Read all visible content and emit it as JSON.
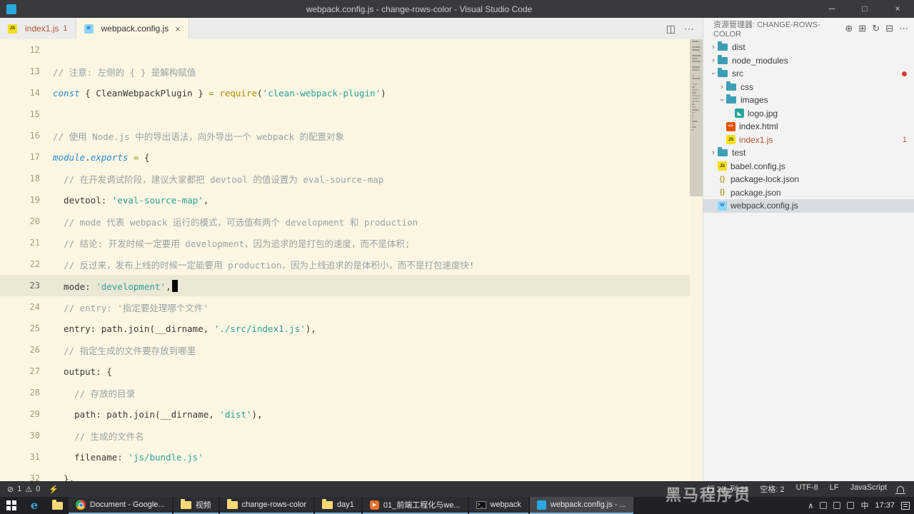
{
  "window": {
    "title": "webpack.config.js - change-rows-color - Visual Studio Code",
    "controls": {
      "minimize": "─",
      "maximize": "□",
      "close": "×"
    }
  },
  "colors": {
    "folder": "#3d9fb5",
    "js_icon": "#f5de19",
    "html_icon": "#e65100",
    "json_icon_text": "#b0a12f",
    "image_icon": "#26a69a",
    "webpack_icon": "#8ed6fb",
    "error_text": "#b4532a",
    "red_dot": "#d2402e",
    "keyword": "#268bd2",
    "string": "#2aa198",
    "comment": "#98a3a3",
    "editor_bg": "#fdf6e3",
    "current_line_bg": "#ece8d6"
  },
  "tabs": [
    {
      "label": "index1.js",
      "icon": "js",
      "badge": "1",
      "error": true,
      "active": false
    },
    {
      "label": "webpack.config.js",
      "icon": "webpack",
      "close": "×",
      "active": true
    }
  ],
  "editor_actions": [
    {
      "name": "split-editor-icon",
      "glyph": "◫"
    },
    {
      "name": "more-actions-icon",
      "glyph": "⋯"
    }
  ],
  "editor": {
    "cursor_line": 23,
    "minimap_head": [
      9,
      0,
      12,
      11,
      0,
      13,
      8,
      12,
      0,
      11,
      10
    ],
    "lines": [
      {
        "n": 12,
        "tokens": []
      },
      {
        "n": 13,
        "tokens": [
          [
            "cm",
            "// 注意: 左侧的 { } 是解构赋值"
          ]
        ]
      },
      {
        "n": 14,
        "tokens": [
          [
            "kw",
            "const"
          ],
          [
            "pn",
            " { CleanWebpackPlugin } "
          ],
          [
            "op",
            "="
          ],
          [
            "pn",
            " "
          ],
          [
            "fn",
            "require"
          ],
          [
            "pn",
            "("
          ],
          [
            "st",
            "'clean-webpack-plugin'"
          ],
          [
            "pn",
            ")"
          ]
        ]
      },
      {
        "n": 15,
        "tokens": []
      },
      {
        "n": 16,
        "tokens": [
          [
            "cm",
            "// 使用 Node.js 中的导出语法，向外导出一个 webpack 的配置对象"
          ]
        ]
      },
      {
        "n": 17,
        "tokens": [
          [
            "kw",
            "module"
          ],
          [
            "pn",
            "."
          ],
          [
            "kw",
            "exports"
          ],
          [
            "pn",
            " "
          ],
          [
            "op",
            "="
          ],
          [
            "pn",
            " {"
          ]
        ]
      },
      {
        "n": 18,
        "tokens": [
          [
            "pn",
            "  "
          ],
          [
            "cm",
            "// 在开发调试阶段，建议大家都把 devtool 的值设置为 eval-source-map"
          ]
        ]
      },
      {
        "n": 19,
        "tokens": [
          [
            "pn",
            "  devtool: "
          ],
          [
            "st",
            "'eval-source-map'"
          ],
          [
            "pn",
            ","
          ]
        ]
      },
      {
        "n": 20,
        "tokens": [
          [
            "pn",
            "  "
          ],
          [
            "cm",
            "// mode 代表 webpack 运行的模式，可选值有两个 development 和 production"
          ]
        ]
      },
      {
        "n": 21,
        "tokens": [
          [
            "pn",
            "  "
          ],
          [
            "cm",
            "// 结论: 开发时候一定要用 development，因为追求的是打包的速度，而不是体积;"
          ]
        ]
      },
      {
        "n": 22,
        "tokens": [
          [
            "pn",
            "  "
          ],
          [
            "cm",
            "// 反过来，发布上线的时候一定能要用 production，因为上线追求的是体积小，而不是打包速度快!"
          ]
        ]
      },
      {
        "n": 23,
        "current": true,
        "cursor": true,
        "tokens": [
          [
            "pn",
            "  mode: "
          ],
          [
            "st",
            "'development'"
          ],
          [
            "pn",
            ","
          ]
        ]
      },
      {
        "n": 24,
        "tokens": [
          [
            "pn",
            "  "
          ],
          [
            "cm",
            "// entry: '指定要处理哪个文件'"
          ]
        ]
      },
      {
        "n": 25,
        "tokens": [
          [
            "pn",
            "  entry: path.join(__dirname, "
          ],
          [
            "st",
            "'./src/index1.js'"
          ],
          [
            "pn",
            "),"
          ]
        ]
      },
      {
        "n": 26,
        "tokens": [
          [
            "pn",
            "  "
          ],
          [
            "cm",
            "// 指定生成的文件要存放到哪里"
          ]
        ]
      },
      {
        "n": 27,
        "tokens": [
          [
            "pn",
            "  output: {"
          ]
        ]
      },
      {
        "n": 28,
        "tokens": [
          [
            "pn",
            "    "
          ],
          [
            "cm",
            "// 存放的目录"
          ]
        ]
      },
      {
        "n": 29,
        "tokens": [
          [
            "pn",
            "    path: path.join(__dirname, "
          ],
          [
            "st",
            "'dist'"
          ],
          [
            "pn",
            "),"
          ]
        ]
      },
      {
        "n": 30,
        "tokens": [
          [
            "pn",
            "    "
          ],
          [
            "cm",
            "// 生成的文件名"
          ]
        ]
      },
      {
        "n": 31,
        "tokens": [
          [
            "pn",
            "    filename: "
          ],
          [
            "st",
            "'js/bundle.js'"
          ]
        ]
      },
      {
        "n": 32,
        "tokens": [
          [
            "pn",
            "  },"
          ]
        ]
      }
    ]
  },
  "explorer": {
    "title": "资源管理器: CHANGE-ROWS-COLOR",
    "chevron_glyph": "›",
    "actions": [
      {
        "name": "new-file-icon",
        "glyph": "⊕"
      },
      {
        "name": "new-folder-icon",
        "glyph": "⊞"
      },
      {
        "name": "refresh-icon",
        "glyph": "↻"
      },
      {
        "name": "collapse-folders-icon",
        "glyph": "⊟"
      },
      {
        "name": "more-icon",
        "glyph": "⋯"
      }
    ],
    "items": [
      {
        "name": "dist",
        "kind": "folder",
        "depth": 0,
        "chevron": "collapsed"
      },
      {
        "name": "node_modules",
        "kind": "folder",
        "depth": 0,
        "chevron": "collapsed"
      },
      {
        "name": "src",
        "kind": "folder",
        "depth": 0,
        "chevron": "expanded",
        "dot": true
      },
      {
        "name": "css",
        "kind": "folder",
        "depth": 1,
        "chevron": "collapsed"
      },
      {
        "name": "images",
        "kind": "folder",
        "depth": 1,
        "chevron": "expanded"
      },
      {
        "name": "logo.jpg",
        "kind": "image",
        "depth": 2
      },
      {
        "name": "index.html",
        "kind": "html",
        "depth": 1
      },
      {
        "name": "index1.js",
        "kind": "js",
        "depth": 1,
        "badge": "1",
        "error": true
      },
      {
        "name": "test",
        "kind": "folder",
        "depth": 0,
        "chevron": "collapsed"
      },
      {
        "name": "babel.config.js",
        "kind": "js",
        "depth": 0
      },
      {
        "name": "package-lock.json",
        "kind": "json",
        "depth": 0
      },
      {
        "name": "package.json",
        "kind": "json",
        "depth": 0
      },
      {
        "name": "webpack.config.js",
        "kind": "webpack",
        "depth": 0,
        "selected": true
      }
    ]
  },
  "status_bar": {
    "error_icon": "⊘",
    "errors": "1",
    "warning_icon": "⚠",
    "warnings": "0",
    "extra_icon": "⚡",
    "right": [
      "行 23, 列 23",
      "空格: 2",
      "UTF-8",
      "LF",
      "JavaScript"
    ]
  },
  "taskbar": {
    "left_icons": [
      {
        "name": "start-button",
        "type": "start"
      },
      {
        "name": "edge-icon",
        "type": "edge",
        "glyph": "e"
      },
      {
        "name": "file-explorer-icon",
        "type": "folder"
      }
    ],
    "buttons": [
      {
        "icon": "chrome",
        "label": "Document - Google..."
      },
      {
        "icon": "folder",
        "label": "视频"
      },
      {
        "icon": "folder",
        "label": "change-rows-color"
      },
      {
        "icon": "folder",
        "label": "day1"
      },
      {
        "icon": "video",
        "label": "01_前端工程化与we...",
        "glyph": "▶"
      },
      {
        "icon": "cmd",
        "label": "webpack",
        "glyph": ">_"
      },
      {
        "icon": "vscode",
        "label": "webpack.config.js - ...",
        "active": true
      }
    ],
    "tray": {
      "chevron": "∧",
      "ime": "中",
      "time": "17:37"
    }
  },
  "watermark": "黑马程序员"
}
